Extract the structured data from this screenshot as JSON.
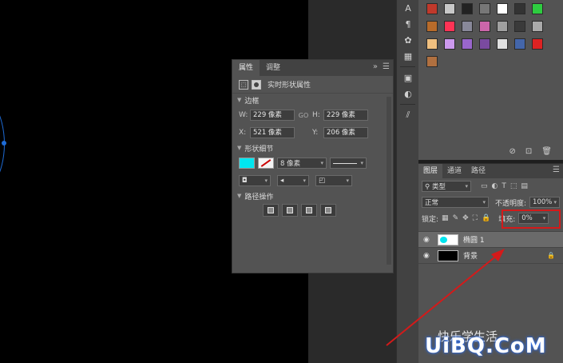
{
  "properties_panel": {
    "tabs": [
      "属性",
      "调整"
    ],
    "tab_controls": "»",
    "title": "实时形状属性",
    "transform_section": "边框",
    "w_label": "W:",
    "w_value": "229 像素",
    "link_label": "GO",
    "h_label": "H:",
    "h_value": "229 像素",
    "x_label": "X:",
    "x_value": "521 像素",
    "y_label": "Y:",
    "y_value": "206 像素",
    "shape_section": "形状细节",
    "stroke_width": "8 像素",
    "path_section": "路径操作"
  },
  "layers_panel": {
    "tabs": [
      "图层",
      "通道",
      "路径"
    ],
    "filter_kind": "类型",
    "blend_mode": "正常",
    "opacity_label": "不透明度:",
    "opacity_value": "100%",
    "lock_label": "锁定:",
    "fill_label": "填充:",
    "fill_value": "0%",
    "layers": [
      {
        "name": "椭圆 1",
        "type": "shape",
        "selected": true
      },
      {
        "name": "背景",
        "type": "background",
        "locked": true
      }
    ]
  },
  "watermark": {
    "text": "UiBQ.CoM",
    "chinese": "快乐学生活"
  },
  "colors": {
    "fill_color": "#00e6f0",
    "highlight": "#d41a1a",
    "selection_path": "#1e6bd6"
  },
  "swatches": [
    "#c0392b",
    "#c8c8c8",
    "#222",
    "#777",
    "#fff",
    "#333",
    "#2ecc40",
    "#b86b2a",
    "#ff3355",
    "#889",
    "#cc66aa",
    "#a0a0a0",
    "#3a3a3a",
    "#aaa",
    "#f0c080",
    "#cc99ee",
    "#9966cc",
    "#7a4aa0",
    "#e0e0e0",
    "#4466aa",
    "#dd2222",
    "#b07040"
  ]
}
